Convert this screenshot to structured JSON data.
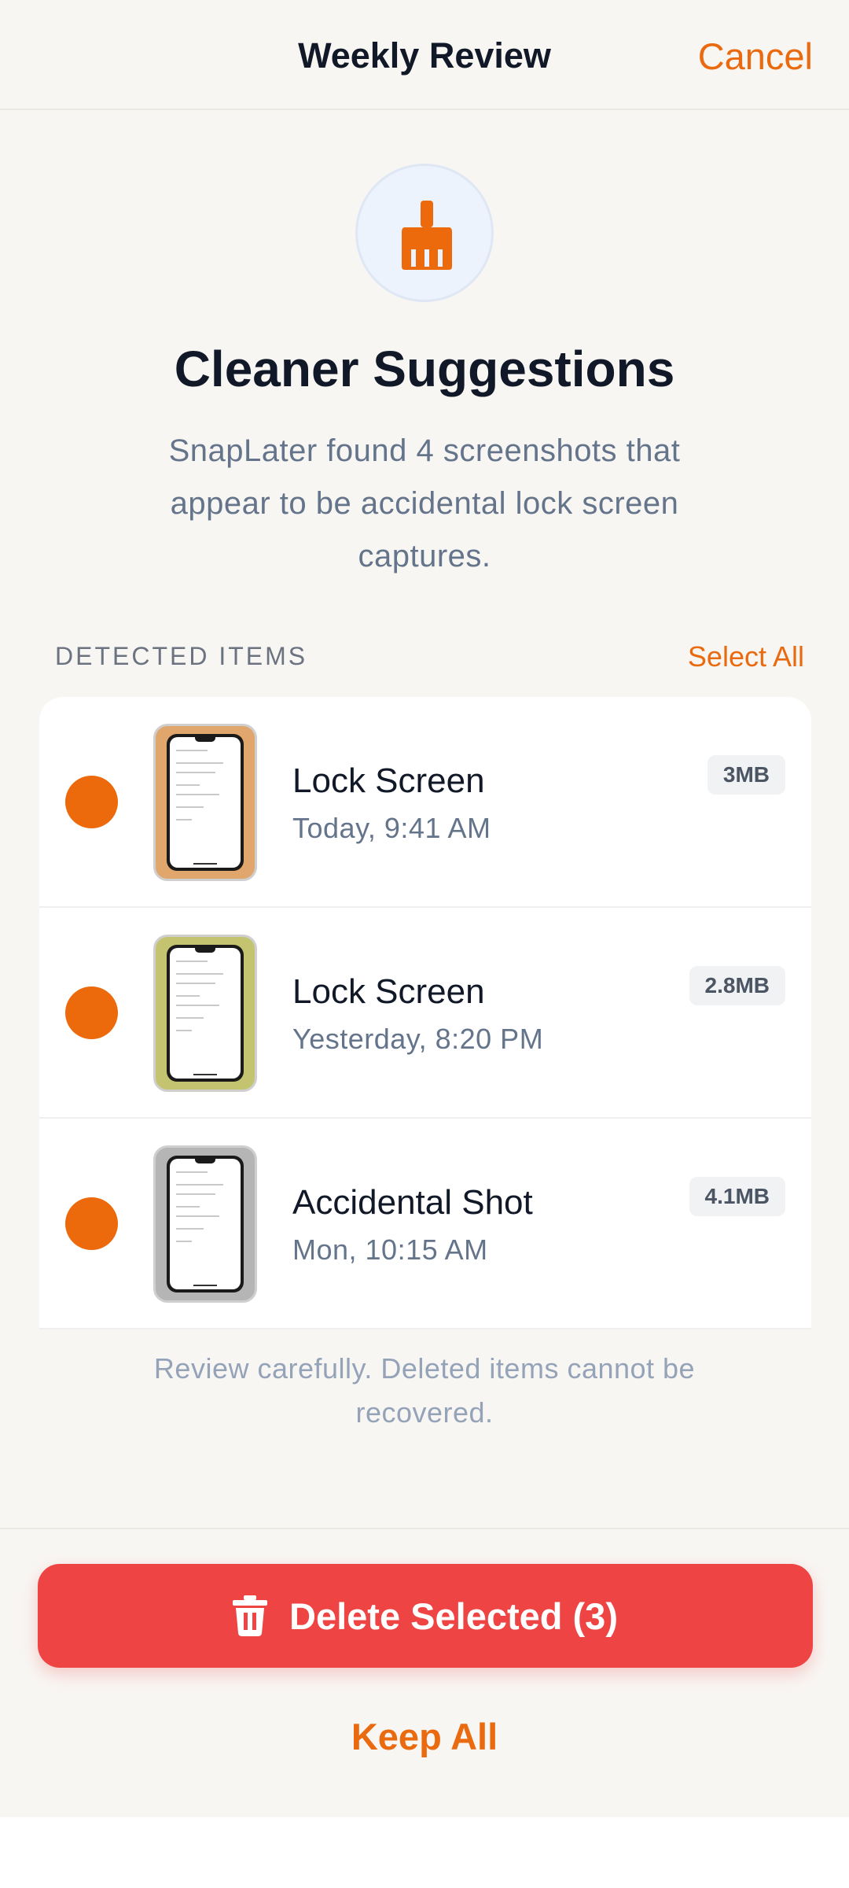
{
  "header": {
    "title": "Weekly Review",
    "cancel_label": "Cancel"
  },
  "hero": {
    "icon": "broom-icon",
    "title": "Cleaner Suggestions",
    "description": "SnapLater found 4 screenshots that appear to be accidental lock screen captures."
  },
  "section": {
    "label": "DETECTED ITEMS",
    "select_all_label": "Select All"
  },
  "items": [
    {
      "title": "Lock Screen",
      "date": "Today, 9:41 AM",
      "size": "3MB",
      "selected": true,
      "thumb_color": "#e0a66c"
    },
    {
      "title": "Lock Screen",
      "date": "Yesterday, 8:20 PM",
      "size": "2.8MB",
      "selected": true,
      "thumb_color": "#c4c470"
    },
    {
      "title": "Accidental Shot",
      "date": "Mon, 10:15 AM",
      "size": "4.1MB",
      "selected": true,
      "thumb_color": "#b5b5b5"
    }
  ],
  "warning": "Review carefully. Deleted items cannot be recovered.",
  "actions": {
    "delete_label": "Delete Selected (3)",
    "delete_icon": "trash-icon",
    "keep_all_label": "Keep All"
  },
  "colors": {
    "accent": "#ea6a10",
    "danger": "#ef4444",
    "background": "#f8f6f3"
  }
}
